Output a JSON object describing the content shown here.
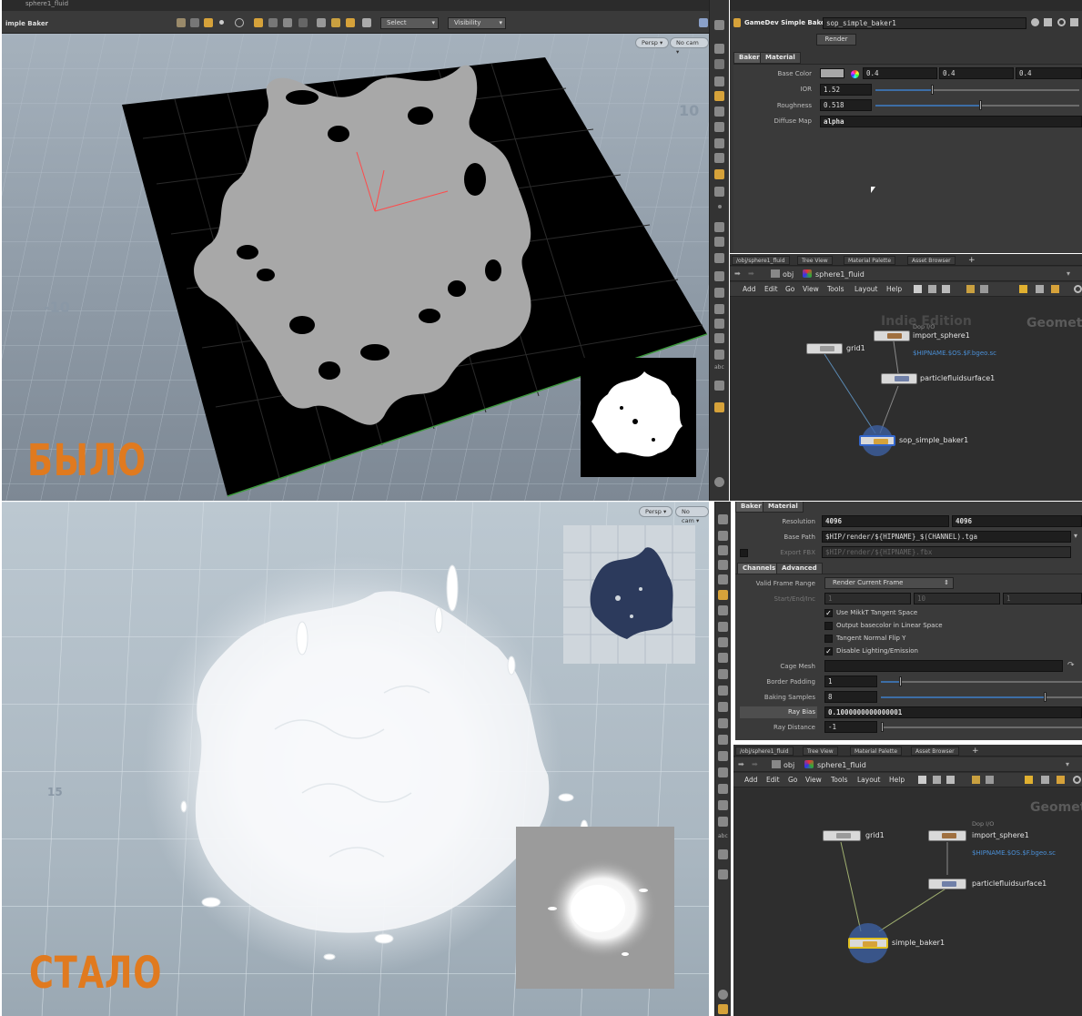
{
  "labels": {
    "before": "БЫЛО",
    "after": "СТАЛО"
  },
  "viewport": {
    "tab": "sphere1_fluid",
    "title": "imple Baker",
    "select_label": "Select",
    "visibility_label": "Visibility",
    "persp": "Persp ▾",
    "nocam": "No cam ▾",
    "axis_neg": "-10",
    "axis_pos": "10",
    "axis_15": "15"
  },
  "params_top": {
    "node_type": "GameDev Simple Baker",
    "node_name": "sop_simple_baker1",
    "render_button": "Render",
    "tabs": [
      "Baker",
      "Material"
    ],
    "base_color_label": "Base Color",
    "base_color": [
      "0.4",
      "0.4",
      "0.4"
    ],
    "ior_label": "IOR",
    "ior": "1.52",
    "ior_fill": 0.28,
    "roughness_label": "Roughness",
    "roughness": "0.518",
    "roughness_fill": 0.52,
    "diffuse_label": "Diffuse Map",
    "diffuse": "alpha"
  },
  "net_top": {
    "tabs": [
      "/obj/sphere1_fluid",
      "Tree View",
      "Material Palette",
      "Asset Browser",
      "+"
    ],
    "path_obj": "obj",
    "path_node": "sphere1_fluid",
    "menu": [
      "Add",
      "Edit",
      "Go",
      "View",
      "Tools",
      "Layout",
      "Help"
    ],
    "watermark": "Indie Edition",
    "geo": "Geomet",
    "nodes": {
      "grid": "grid1",
      "dopio": "Dop I/O",
      "import": "import_sphere1",
      "hipname": "$HIPNAME.$OS.$F.bgeo.sc",
      "pfs": "particlefluidsurface1",
      "baker": "sop_simple_baker1"
    }
  },
  "params_bot": {
    "tabs": [
      "Baker",
      "Material"
    ],
    "resolution_label": "Resolution",
    "resolution": [
      "4096",
      "4096"
    ],
    "basepath_label": "Base Path",
    "basepath": "$HIP/render/${HIPNAME}_$(CHANNEL).tga",
    "exportfbx_label": "Export FBX",
    "exportfbx": "$HIP/render/${HIPNAME}.fbx",
    "subtabs": [
      "Channels",
      "Advanced"
    ],
    "frame_range_label": "Valid Frame Range",
    "frame_range": "Render Current Frame",
    "startend_label": "Start/End/Inc",
    "startend": [
      "1",
      "10",
      "1"
    ],
    "checks": [
      {
        "label": "Use MikkT Tangent Space",
        "on": true
      },
      {
        "label": "Output basecolor in Linear Space",
        "on": false
      },
      {
        "label": "Tangent Normal Flip Y",
        "on": false
      },
      {
        "label": "Disable Lighting/Emission",
        "on": true
      }
    ],
    "cage_label": "Cage Mesh",
    "cage": "",
    "border_label": "Border Padding",
    "border": "1",
    "border_fill": 0.1,
    "samples_label": "Baking Samples",
    "samples": "8",
    "samples_fill": 0.82,
    "raybias_label": "Ray Bias",
    "raybias": "0.1000000000000001",
    "raydist_label": "Ray Distance",
    "raydist": "-1"
  },
  "net_bot": {
    "tabs": [
      "/obj/sphere1_fluid",
      "Tree View",
      "Material Palette",
      "Asset Browser",
      "+"
    ],
    "path_obj": "obj",
    "path_node": "sphere1_fluid",
    "menu": [
      "Add",
      "Edit",
      "Go",
      "View",
      "Tools",
      "Layout",
      "Help"
    ],
    "geo": "Geomet",
    "nodes": {
      "grid": "grid1",
      "dopio": "Dop I/O",
      "import": "import_sphere1",
      "hipname": "$HIPNAME.$OS.$F.bgeo.sc",
      "pfs": "particlefluidsurface1",
      "baker": "simple_baker1"
    }
  },
  "colors": {
    "accent": "#e07a1f",
    "link": "#4a8fd6",
    "slider": "#3d6ea6"
  }
}
